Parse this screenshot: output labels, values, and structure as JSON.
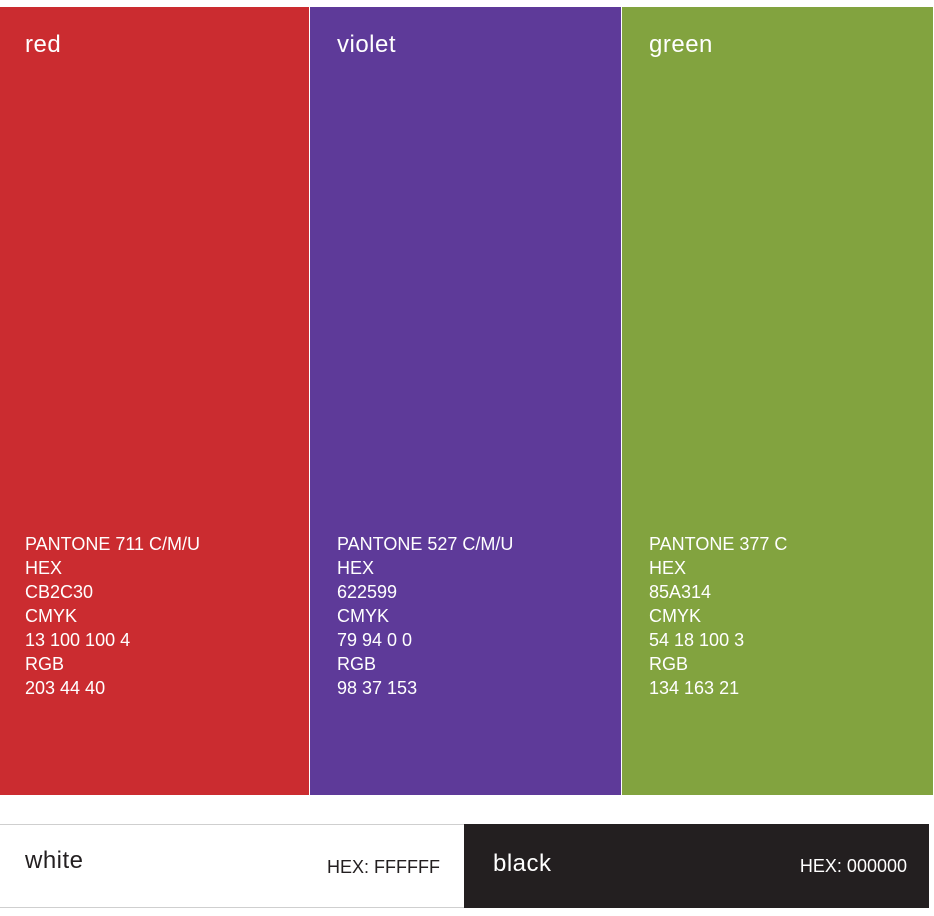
{
  "swatches": [
    {
      "name": "red",
      "color": "#CB2C30",
      "pantone": "PANTONE 711 C/M/U",
      "hex_label": "HEX",
      "hex": "CB2C30",
      "cmyk_label": "CMYK",
      "cmyk": "13 100 100 4",
      "rgb_label": "RGB",
      "rgb": "203 44 40"
    },
    {
      "name": "violet",
      "color": "#5E3A99",
      "pantone": "PANTONE 527 C/M/U",
      "hex_label": "HEX",
      "hex": "622599",
      "cmyk_label": "CMYK",
      "cmyk": "79 94 0 0",
      "rgb_label": "RGB",
      "rgb": "98 37 153"
    },
    {
      "name": "green",
      "color": "#82A33F",
      "pantone": "PANTONE 377 C",
      "hex_label": "HEX",
      "hex": "85A314",
      "cmyk_label": "CMYK",
      "cmyk": "54 18 100 3",
      "rgb_label": "RGB",
      "rgb": "134 163 21"
    }
  ],
  "neutrals": {
    "white": {
      "name": "white",
      "hex_text": "HEX: FFFFFF",
      "color": "#FFFFFF"
    },
    "black": {
      "name": "black",
      "hex_text": "HEX: 000000",
      "color": "#231F20"
    }
  }
}
